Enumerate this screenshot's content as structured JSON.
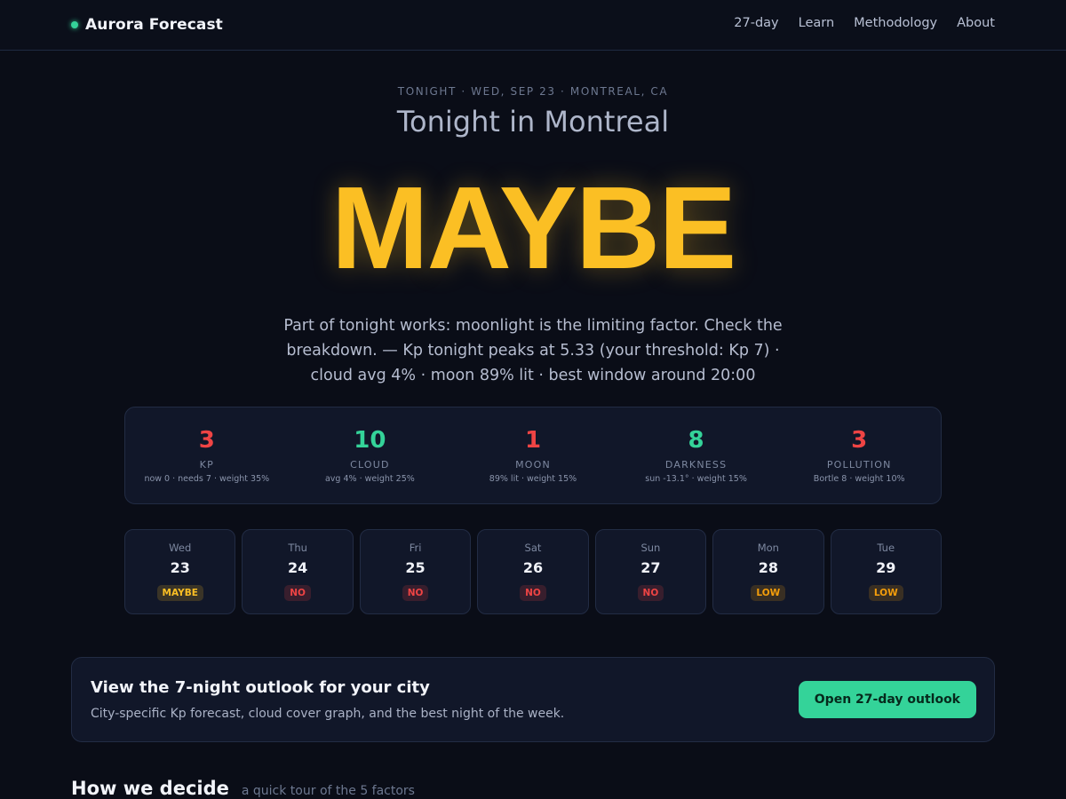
{
  "header": {
    "brand": "Aurora Forecast",
    "nav": [
      {
        "label": "27-day"
      },
      {
        "label": "Learn"
      },
      {
        "label": "Methodology"
      },
      {
        "label": "About"
      }
    ]
  },
  "hero": {
    "eyebrow": "TONIGHT · WED, SEP 23 · MONTREAL, CA",
    "title": "Tonight in Montreal",
    "verdict": "MAYBE",
    "summary": "Part of tonight works: moonlight is the limiting factor. Check the breakdown. — Kp tonight peaks at 5.33 (your threshold: Kp 7) · cloud avg 4% · moon 89% lit · best window around 20:00"
  },
  "colors": {
    "good": "#34d399",
    "bad": "#ef4444",
    "maybe": "#fbbf24",
    "low": "#f59e0b"
  },
  "factors": [
    {
      "score": "3",
      "label": "KP",
      "detail": "now 0 · needs 7 · weight 35%",
      "status": "bad"
    },
    {
      "score": "10",
      "label": "CLOUD",
      "detail": "avg 4% · weight 25%",
      "status": "good"
    },
    {
      "score": "1",
      "label": "MOON",
      "detail": "89% lit · weight 15%",
      "status": "bad"
    },
    {
      "score": "8",
      "label": "DARKNESS",
      "detail": "sun -13.1° · weight 15%",
      "status": "good"
    },
    {
      "score": "3",
      "label": "POLLUTION",
      "detail": "Bortle 8 · weight 10%",
      "status": "bad"
    }
  ],
  "days": [
    {
      "name": "Wed",
      "num": "23",
      "badge": "MAYBE",
      "status": "maybe"
    },
    {
      "name": "Thu",
      "num": "24",
      "badge": "NO",
      "status": "no"
    },
    {
      "name": "Fri",
      "num": "25",
      "badge": "NO",
      "status": "no"
    },
    {
      "name": "Sat",
      "num": "26",
      "badge": "NO",
      "status": "no"
    },
    {
      "name": "Sun",
      "num": "27",
      "badge": "NO",
      "status": "no"
    },
    {
      "name": "Mon",
      "num": "28",
      "badge": "LOW",
      "status": "low"
    },
    {
      "name": "Tue",
      "num": "29",
      "badge": "LOW",
      "status": "low"
    }
  ],
  "cta": {
    "title": "View the 7-night outlook for your city",
    "subtitle": "City-specific Kp forecast, cloud cover graph, and the best night of the week.",
    "button": "Open 27-day outlook"
  },
  "section": {
    "title": "How we decide",
    "subtitle": "a quick tour of the 5 factors"
  }
}
